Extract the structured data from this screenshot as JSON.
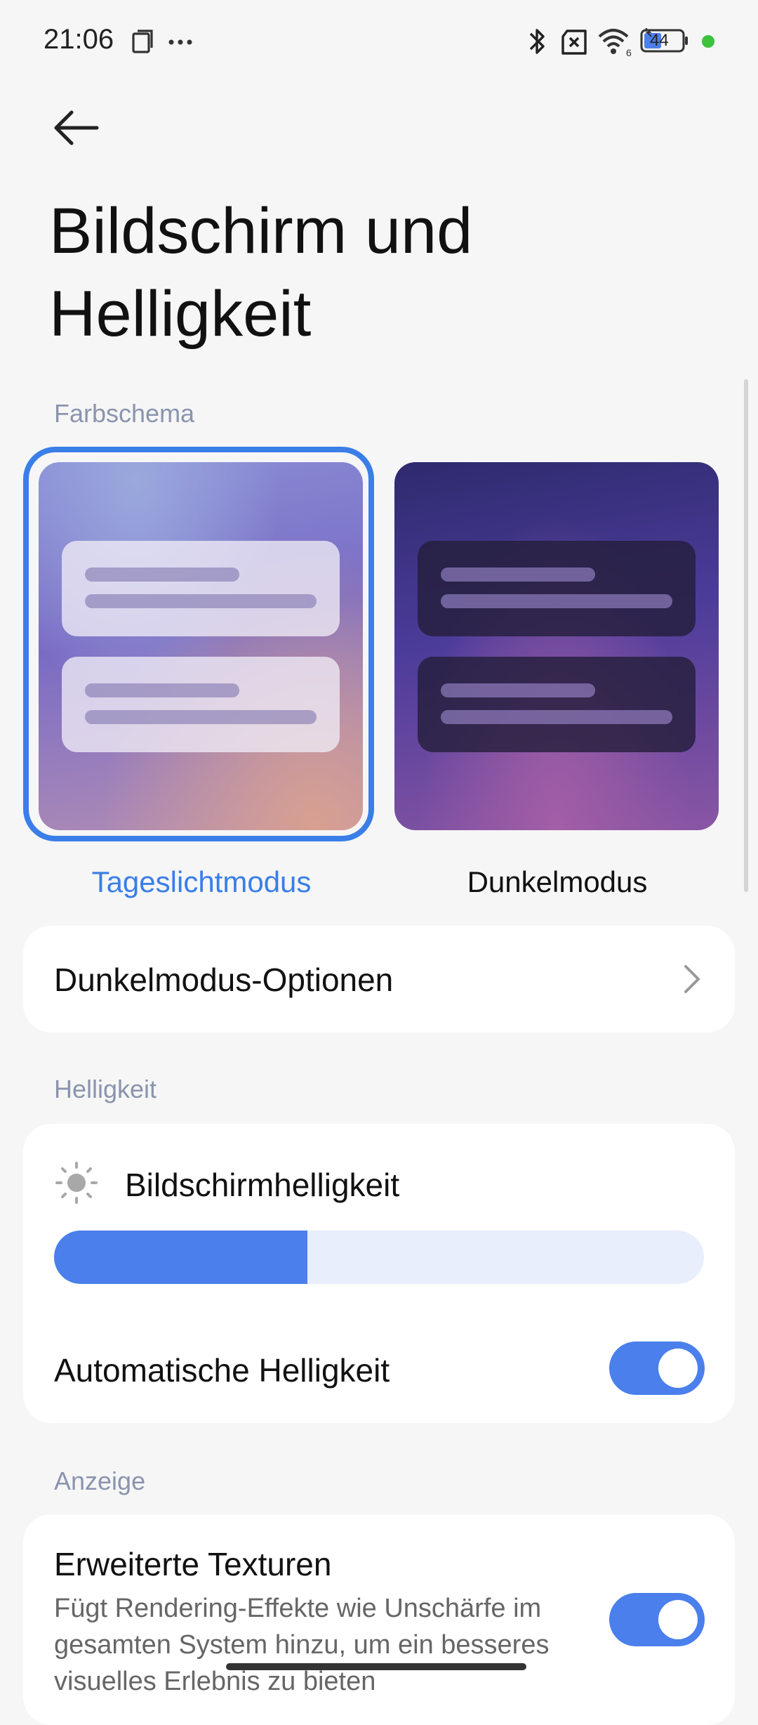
{
  "status_bar": {
    "time": "21:06",
    "left_icons": [
      "screenshot-icon",
      "more-dots-icon"
    ],
    "right_icons": [
      "bluetooth-icon",
      "no-sim-icon",
      "wifi-icon",
      "battery-icon",
      "green-dot"
    ],
    "wifi_label": "6",
    "battery_level": "44",
    "dot_color": "#3cc23c"
  },
  "header": {
    "back_icon": "arrow-left-icon",
    "title_line1": "Bildschirm und",
    "title_line2": "Helligkeit"
  },
  "color_scheme": {
    "section_label": "Farbschema",
    "options": [
      {
        "label": "Tageslichtmodus",
        "selected": true
      },
      {
        "label": "Dunkelmodus",
        "selected": false
      }
    ],
    "accent": "#3a7ee8"
  },
  "dark_options_row": {
    "label": "Dunkelmodus-Optionen",
    "icon": "chevron-right-icon"
  },
  "brightness": {
    "section_label": "Helligkeit",
    "title": "Bildschirmhelligkeit",
    "icon": "sun-icon",
    "level_fraction": 0.39,
    "auto_label": "Automatische Helligkeit",
    "auto_on": true
  },
  "display": {
    "section_label": "Anzeige",
    "textures_title": "Erweiterte Texturen",
    "textures_desc_line1": "Fügt Rendering-Effekte wie Unschärfe im",
    "textures_desc_line2": "gesamten System hinzu, um ein besseres",
    "textures_desc_line3": "visuelles Erlebnis zu bieten",
    "textures_on": true
  }
}
